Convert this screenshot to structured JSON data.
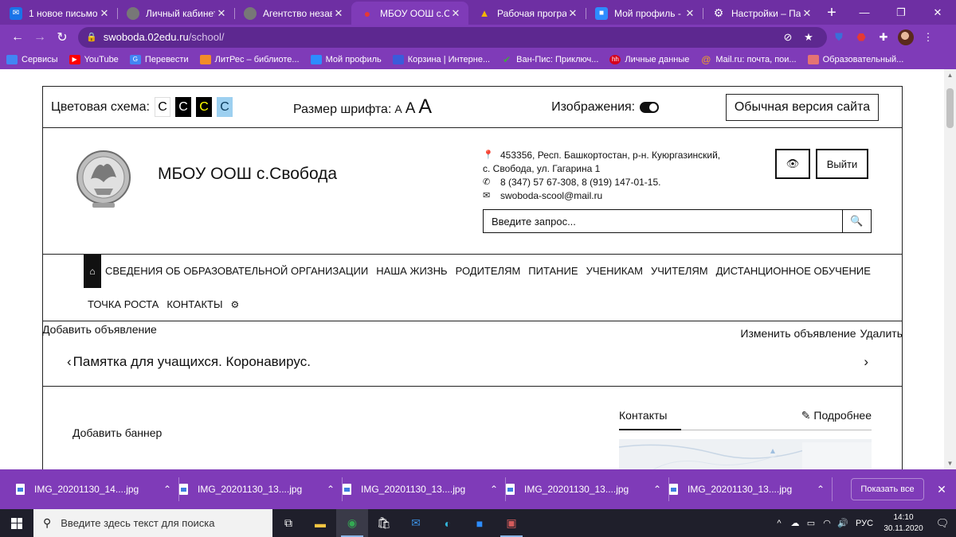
{
  "browser": {
    "tabs": [
      {
        "title": "1 новое письмо",
        "icon": "mail-icon",
        "color": "#1a73e8"
      },
      {
        "title": "Личный кабинет",
        "icon": "globe-icon",
        "color": "#777777"
      },
      {
        "title": "Агентство незави",
        "icon": "globe-icon",
        "color": "#777777"
      },
      {
        "title": "МБОУ ООШ с.Сво",
        "icon": "location-pin-icon",
        "color": "#e53935",
        "active": true
      },
      {
        "title": "Рабочая програм",
        "icon": "google-drive-icon",
        "color": "#f4b400"
      },
      {
        "title": "Мой профиль - Zo",
        "icon": "zoom-icon",
        "color": "#2d8cff"
      },
      {
        "title": "Настройки – Паро",
        "icon": "gear-icon",
        "color": "#ffffff"
      }
    ],
    "new_tab": "+",
    "address": {
      "domain": "swoboda.02edu.ru",
      "path": "/school/"
    }
  },
  "bookmarks": [
    {
      "label": "Сервисы",
      "icon": "apps-icon",
      "color": "#4285f4"
    },
    {
      "label": "YouTube",
      "icon": "youtube-icon",
      "color": "#ff0000"
    },
    {
      "label": "Перевести",
      "icon": "translate-icon",
      "color": "#4285f4"
    },
    {
      "label": "ЛитРес – библиоте...",
      "icon": "litres-icon",
      "color": "#f28c28"
    },
    {
      "label": "Мой профиль",
      "icon": "book-icon",
      "color": "#2d8cff"
    },
    {
      "label": "Корзина | Интерне...",
      "icon": "labirint-icon",
      "color": "#3b5bdb"
    },
    {
      "label": "Ван-Пис: Приключ...",
      "icon": "check-icon",
      "color": "#43a047"
    },
    {
      "label": "Личные данные",
      "icon": "hh-icon",
      "color": "#d6001c"
    },
    {
      "label": "Mail.ru: почта, пои...",
      "icon": "at-icon",
      "color": "#f5a623"
    },
    {
      "label": "Образовательный...",
      "icon": "school-icon",
      "color": "#e57373"
    }
  ],
  "site": {
    "a11y": {
      "color_scheme_label": "Цветовая схема:",
      "swatch_letter": "С",
      "font_size_label": "Размер шрифта:",
      "font_letter": "А",
      "images_label": "Изображения:",
      "normal_version": "Обычная версия сайта"
    },
    "header": {
      "school_name": "МБОУ ООШ с.Свобода",
      "address_line1": "453356, Респ. Башкортостан, р-н. Куюргазинский,",
      "address_line2": "с. Свобода, ул. Гагарина 1",
      "phones": "8 (347) 57 67-308, 8 (919) 147-01-15.",
      "email": "swoboda-scool@mail.ru",
      "logout": "Выйти",
      "search_placeholder": "Введите запрос..."
    },
    "menu": {
      "line1": [
        "СВЕДЕНИЯ ОБ ОБРАЗОВАТЕЛЬНОЙ ОРГАНИЗАЦИИ",
        "НАША ЖИЗНЬ",
        "РОДИТЕЛЯМ",
        "ПИТАНИЕ",
        "УЧЕНИКАМ",
        "УЧИТЕЛЯМ",
        "ДИСТАНЦИОННОЕ ОБУЧЕНИЕ"
      ],
      "line2": [
        "ТОЧКА РОСТА",
        "КОНТАКТЫ"
      ]
    },
    "announcements": {
      "add": "Добавить объявление",
      "edit": "Изменить объявление",
      "delete": "Удалить",
      "current": "Памятка для учащихся. Коронавирус."
    },
    "banner_add": "Добавить баннер",
    "sidebar": {
      "tab_contacts": "Контакты",
      "more": "Подробнее"
    }
  },
  "downloads": {
    "items": [
      "IMG_20201130_14....jpg",
      "IMG_20201130_13....jpg",
      "IMG_20201130_13....jpg",
      "IMG_20201130_13....jpg",
      "IMG_20201130_13....jpg"
    ],
    "show_all": "Показать все"
  },
  "taskbar": {
    "search_placeholder": "Введите здесь текст для поиска",
    "language": "РУС",
    "time": "14:10",
    "date": "30.11.2020"
  }
}
